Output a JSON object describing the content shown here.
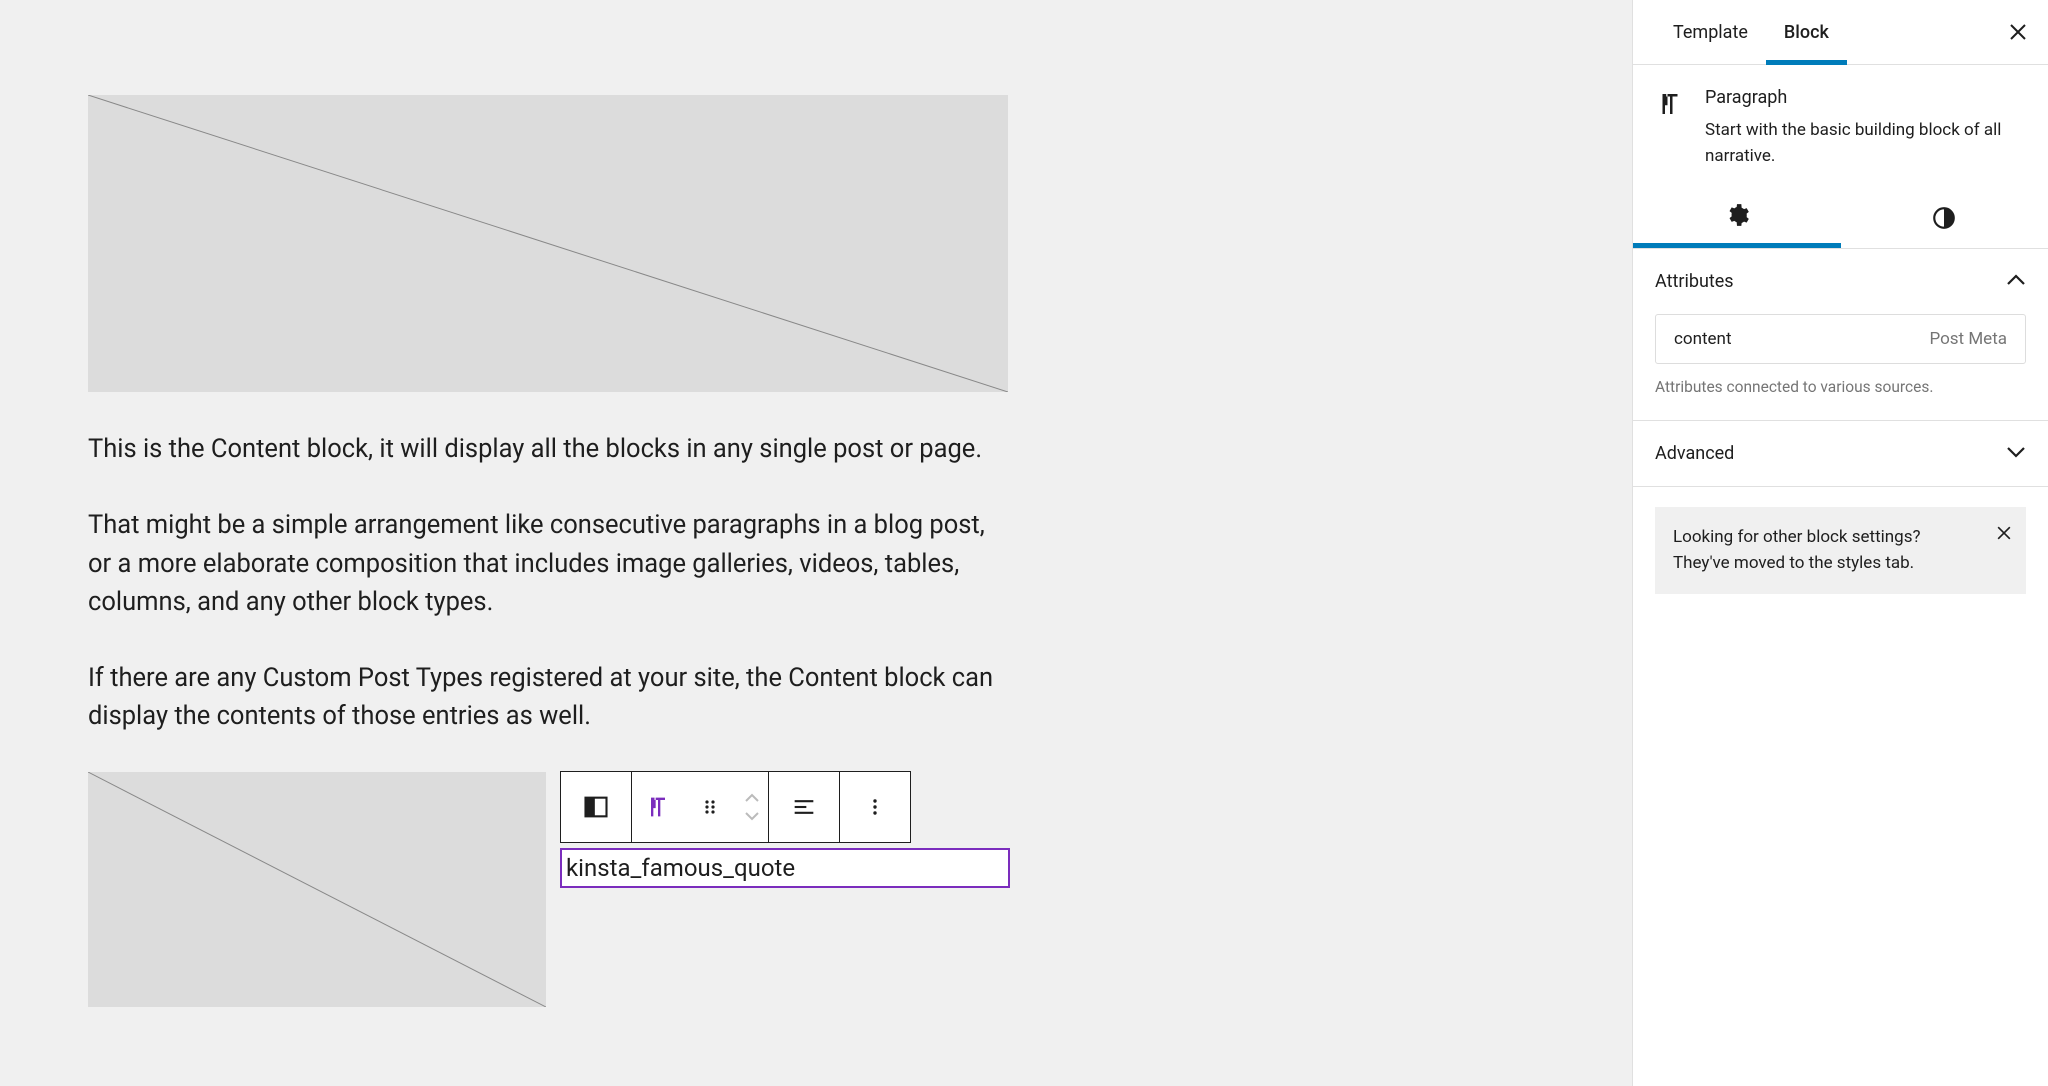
{
  "editor": {
    "paragraphs": [
      "This is the Content block, it will display all the blocks in any single post or page.",
      "That might be a simple arrangement like consecutive paragraphs in a blog post, or a more elaborate composition that includes image galleries, videos, tables, columns, and any other block types.",
      "If there are any Custom Post Types registered at your site, the Content block can display the contents of those entries as well."
    ],
    "selected_block_text": "kinsta_famous_quote"
  },
  "sidebar": {
    "tabs": {
      "template": "Template",
      "block": "Block"
    },
    "block_info": {
      "title": "Paragraph",
      "description": "Start with the basic building block of all narrative."
    },
    "panels": {
      "attributes": {
        "title": "Attributes",
        "row": {
          "name": "content",
          "type": "Post Meta"
        },
        "help": "Attributes connected to various sources."
      },
      "advanced": {
        "title": "Advanced"
      }
    },
    "notice": "Looking for other block settings? They've moved to the styles tab."
  }
}
